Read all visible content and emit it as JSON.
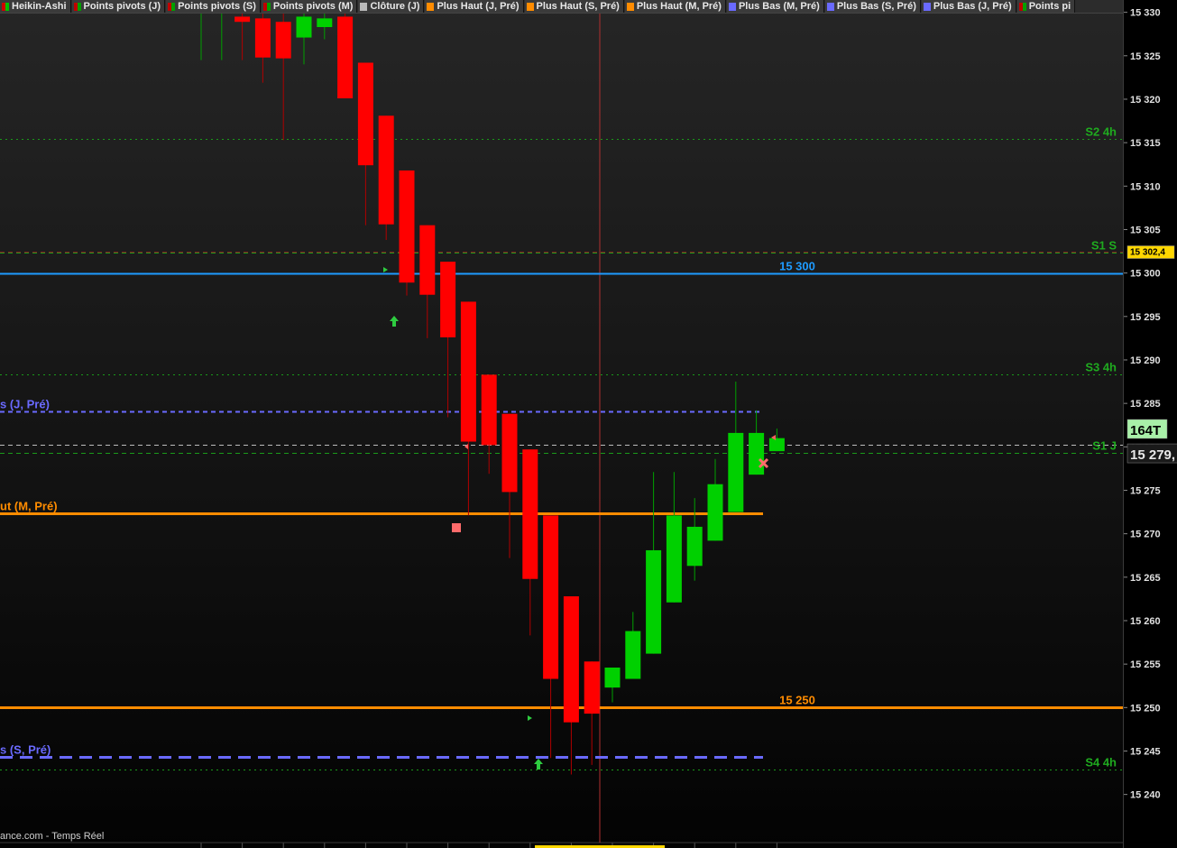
{
  "toolbar": {
    "tabs": [
      {
        "label": "Heikin-Ashi",
        "swatch": [
          "#d00000",
          "#00c000"
        ]
      },
      {
        "label": "Points pivots (J)",
        "swatch": [
          "#c00000",
          "#00a000"
        ]
      },
      {
        "label": "Points pivots (S)",
        "swatch": [
          "#c00000",
          "#00a000"
        ]
      },
      {
        "label": "Points pivots (M)",
        "swatch": [
          "#c00000",
          "#00a000"
        ]
      },
      {
        "label": "Clôture (J)",
        "swatch": [
          "#bbbbbb",
          "#bbbbbb"
        ]
      },
      {
        "label": "Plus Haut (J, Pré)",
        "swatch": [
          "#ff8c00",
          "#ff8c00"
        ]
      },
      {
        "label": "Plus Haut (S, Pré)",
        "swatch": [
          "#ff8c00",
          "#ff8c00"
        ]
      },
      {
        "label": "Plus Haut (M, Pré)",
        "swatch": [
          "#ff8c00",
          "#ff8c00"
        ]
      },
      {
        "label": "Plus Bas (M, Pré)",
        "swatch": [
          "#6a6aff",
          "#6a6aff"
        ]
      },
      {
        "label": "Plus Bas (S, Pré)",
        "swatch": [
          "#6a6aff",
          "#6a6aff"
        ]
      },
      {
        "label": "Plus Bas (J, Pré)",
        "swatch": [
          "#6a6aff",
          "#6a6aff"
        ]
      },
      {
        "label": "Points pi",
        "swatch": [
          "#c00000",
          "#00a000"
        ]
      }
    ]
  },
  "footer": {
    "source": "ance.com - Temps Réel"
  },
  "colors": {
    "up": "#00d000",
    "down": "#ff0000",
    "pivot": "#1a9a1a",
    "orange": "#ff8c00",
    "blue": "#1e9bff",
    "lowline": "#6a6aff"
  },
  "chart_data": {
    "type": "candlestick",
    "ylim": [
      15235.5,
      15331
    ],
    "y_ticks": [
      15330,
      15325,
      15320,
      15315,
      15310,
      15305,
      15300,
      15295,
      15290,
      15285,
      15280,
      15275,
      15270,
      15265,
      15260,
      15255,
      15250,
      15245,
      15240
    ],
    "candles": [
      {
        "o": 15330.6,
        "h": 15332,
        "l": 15324.5,
        "c": 15330.6
      },
      {
        "o": 15330.6,
        "h": 15332,
        "l": 15324.5,
        "c": 15330.6
      },
      {
        "o": 15329.5,
        "h": 15332,
        "l": 15324.5,
        "c": 15328.9
      },
      {
        "o": 15329.3,
        "h": 15332,
        "l": 15321.9,
        "c": 15324.8
      },
      {
        "o": 15328.9,
        "h": 15332,
        "l": 15315.3,
        "c": 15324.7
      },
      {
        "o": 15327.1,
        "h": 15332,
        "l": 15324,
        "c": 15329.5
      },
      {
        "o": 15328.3,
        "h": 15331,
        "l": 15326.9,
        "c": 15329.3
      },
      {
        "o": 15329.5,
        "h": 15332,
        "l": 15320.1,
        "c": 15320.1
      },
      {
        "o": 15324.2,
        "h": 15324.2,
        "l": 15305.5,
        "c": 15312.4
      },
      {
        "o": 15318.1,
        "h": 15318.1,
        "l": 15303.8,
        "c": 15305.6
      },
      {
        "o": 15311.8,
        "h": 15311.8,
        "l": 15297.4,
        "c": 15298.9
      },
      {
        "o": 15305.5,
        "h": 15305.5,
        "l": 15292.5,
        "c": 15297.5
      },
      {
        "o": 15301.3,
        "h": 15301.3,
        "l": 15283.4,
        "c": 15292.6
      },
      {
        "o": 15296.7,
        "h": 15296.7,
        "l": 15272.1,
        "c": 15280.6
      },
      {
        "o": 15288.3,
        "h": 15288.3,
        "l": 15276.9,
        "c": 15280.2
      },
      {
        "o": 15283.8,
        "h": 15283.8,
        "l": 15267.2,
        "c": 15274.8
      },
      {
        "o": 15279.7,
        "h": 15279.7,
        "l": 15258.3,
        "c": 15264.8
      },
      {
        "o": 15272.1,
        "h": 15272.1,
        "l": 15244.2,
        "c": 15253.3
      },
      {
        "o": 15262.8,
        "h": 15262.8,
        "l": 15242.3,
        "c": 15248.3
      },
      {
        "o": 15255.3,
        "h": 15255.3,
        "l": 15243.4,
        "c": 15249.3
      },
      {
        "o": 15252.3,
        "h": 15254.5,
        "l": 15250.6,
        "c": 15254.6
      },
      {
        "o": 15253.3,
        "h": 15261,
        "l": 15253.3,
        "c": 15258.8
      },
      {
        "o": 15256.2,
        "h": 15277.1,
        "l": 15256.2,
        "c": 15268.1
      },
      {
        "o": 15262.1,
        "h": 15277.1,
        "l": 15262.1,
        "c": 15272.1
      },
      {
        "o": 15266.3,
        "h": 15274.1,
        "l": 15264.6,
        "c": 15270.8
      },
      {
        "o": 15269.2,
        "h": 15278.6,
        "l": 15269.2,
        "c": 15275.7
      },
      {
        "o": 15272.5,
        "h": 15287.5,
        "l": 15272.5,
        "c": 15281.6
      },
      {
        "o": 15276.8,
        "h": 15284.2,
        "l": 15276.8,
        "c": 15281.6
      },
      {
        "o": 15279.5,
        "h": 15282.1,
        "l": 15279.5,
        "c": 15281.0
      }
    ],
    "levels": [
      {
        "price": 15315.4,
        "style": "dotted",
        "color": "#1a9a1a",
        "label": "S2 4h"
      },
      {
        "price": 15302.4,
        "style": "dashed",
        "color": "#1a9a1a",
        "label": "S1 S"
      },
      {
        "price": 15300,
        "style": "solid",
        "color": "#1e9bff",
        "label": "15 300"
      },
      {
        "price": 15288.3,
        "style": "dotted",
        "color": "#1a9a1a",
        "label": "S3 4h"
      },
      {
        "price": 15284.1,
        "style": "dashed",
        "color": "#6a6aff",
        "label": "s (J, Pré)"
      },
      {
        "price": 15280.2,
        "style": "dashed",
        "color": "#bbbbbb",
        "label": ""
      },
      {
        "price": 15279.3,
        "style": "dashed",
        "color": "#1a9a1a",
        "label": "S1 J"
      },
      {
        "price": 15272.3,
        "style": "solid",
        "color": "#ff8c00",
        "label": "ut (M, Pré)"
      },
      {
        "price": 15250,
        "style": "solid",
        "color": "#ff8c00",
        "label": "15 250"
      },
      {
        "price": 15244.3,
        "style": "dashed",
        "color": "#6a6aff",
        "label": "s (S, Pré)"
      },
      {
        "price": 15242.9,
        "style": "dotted",
        "color": "#1a9a1a",
        "label": "S4 4h"
      }
    ],
    "price_tags": [
      {
        "text": "15 302,4",
        "bg": "#ffd700",
        "fg": "#000000"
      },
      {
        "text": "164T",
        "bg": "#a8f0a8",
        "fg": "#000000"
      },
      {
        "text": "15 279,",
        "bg": "#1a1a1a",
        "fg": "#e8e8e8"
      }
    ]
  }
}
